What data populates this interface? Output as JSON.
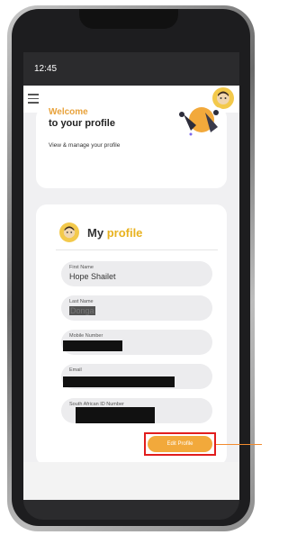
{
  "status_bar": {
    "time": "12:45"
  },
  "welcome_card": {
    "heading": "Welcome",
    "subheading": "to your profile",
    "hint": "View & manage your profile"
  },
  "profile_card": {
    "title_prefix": "My",
    "title_accent": "profile",
    "fields": [
      {
        "label": "First Name",
        "value": "Hope Shailet"
      },
      {
        "label": "Last Name",
        "value": "Donga"
      },
      {
        "label": "Mobile Number",
        "value": ""
      },
      {
        "label": "Email",
        "value": ""
      },
      {
        "label": "South African ID Number",
        "value": ""
      }
    ],
    "edit_button_label": "Edit Profile"
  },
  "colors": {
    "accent": "#f2a93b",
    "highlight_border": "#e11d1d",
    "pointer_line": "#f28b2e"
  },
  "icons": [
    "menu-icon",
    "avatar-icon",
    "profile-avatar-icon",
    "illustration"
  ]
}
